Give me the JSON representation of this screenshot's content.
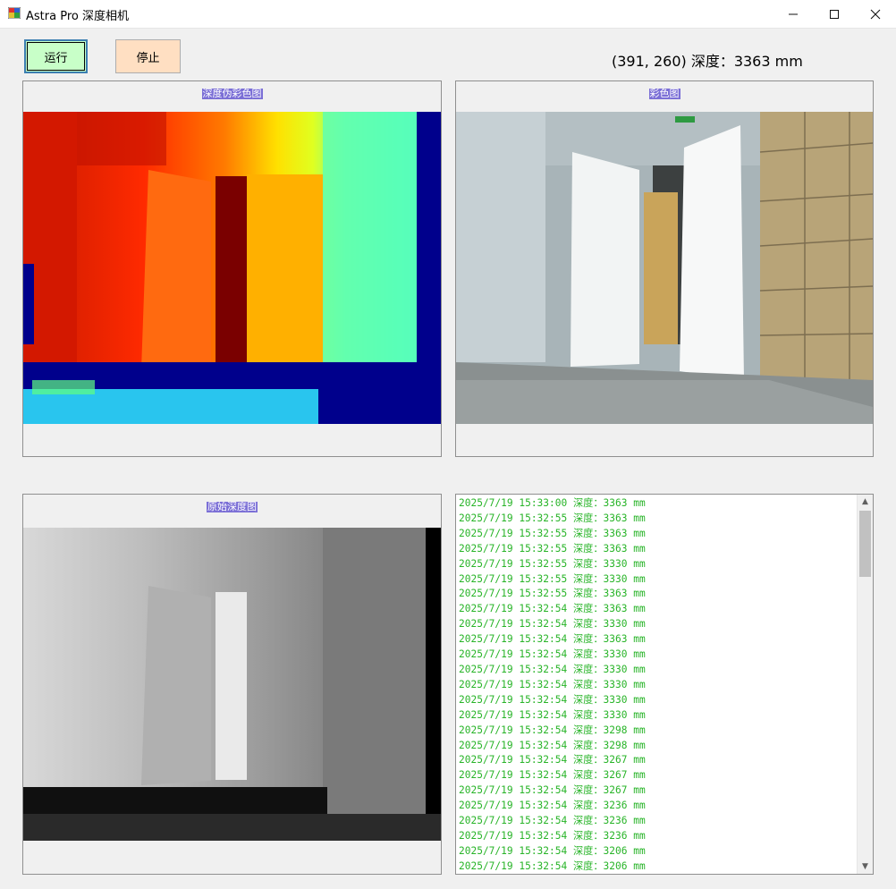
{
  "window": {
    "title": "Astra Pro 深度相机",
    "minimize_icon": "minimize-icon",
    "maximize_icon": "maximize-icon",
    "close_icon": "close-icon"
  },
  "toolbar": {
    "run_label": "运行",
    "stop_label": "停止",
    "run_color": "#c8ffc8",
    "stop_color": "#ffdfc2"
  },
  "depth_readout": "(391, 260) 深度：3363 mm",
  "panels": {
    "pseudo_color_title": "深度伪彩色图",
    "color_title": "彩色图",
    "raw_depth_title": "原始深度图"
  },
  "log": {
    "text_color": "#28b428",
    "lines": [
      "2025/7/19 15:33:00 深度：3363 mm",
      "2025/7/19 15:32:55 深度：3363 mm",
      "2025/7/19 15:32:55 深度：3363 mm",
      "2025/7/19 15:32:55 深度：3363 mm",
      "2025/7/19 15:32:55 深度：3330 mm",
      "2025/7/19 15:32:55 深度：3330 mm",
      "2025/7/19 15:32:55 深度：3363 mm",
      "2025/7/19 15:32:54 深度：3363 mm",
      "2025/7/19 15:32:54 深度：3330 mm",
      "2025/7/19 15:32:54 深度：3363 mm",
      "2025/7/19 15:32:54 深度：3330 mm",
      "2025/7/19 15:32:54 深度：3330 mm",
      "2025/7/19 15:32:54 深度：3330 mm",
      "2025/7/19 15:32:54 深度：3330 mm",
      "2025/7/19 15:32:54 深度：3330 mm",
      "2025/7/19 15:32:54 深度：3298 mm",
      "2025/7/19 15:32:54 深度：3298 mm",
      "2025/7/19 15:32:54 深度：3267 mm",
      "2025/7/19 15:32:54 深度：3267 mm",
      "2025/7/19 15:32:54 深度：3267 mm",
      "2025/7/19 15:32:54 深度：3236 mm",
      "2025/7/19 15:32:54 深度：3236 mm",
      "2025/7/19 15:32:54 深度：3236 mm",
      "2025/7/19 15:32:54 深度：3206 mm",
      "2025/7/19 15:32:54 深度：3206 mm"
    ]
  }
}
